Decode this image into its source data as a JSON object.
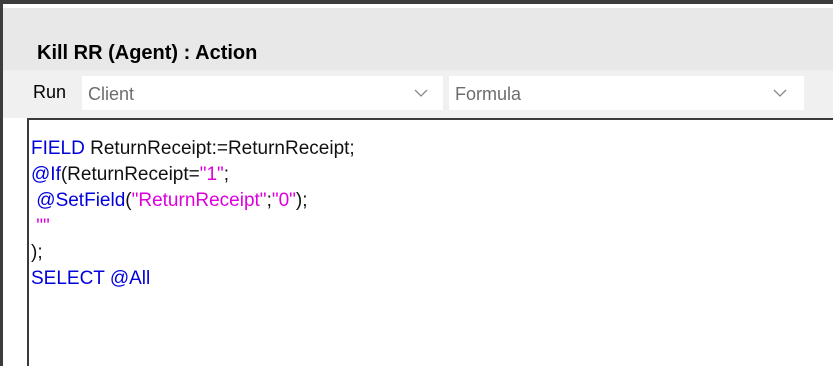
{
  "window": {
    "title": "Kill RR (Agent) : Action"
  },
  "run_row": {
    "label": "Run",
    "client_select": {
      "value": "Client",
      "icon": "chevron-down-icon"
    },
    "type_select": {
      "value": "Formula",
      "icon": "chevron-down-icon"
    }
  },
  "editor": {
    "line1": {
      "keyword": "FIELD",
      "text": " ReturnReceipt:=ReturnReceipt;"
    },
    "line2": {
      "keyword": "@If",
      "text_a": "(ReturnReceipt=",
      "string": "\"1\"",
      "text_b": ";"
    },
    "line3": {
      "indent": " ",
      "keyword": "@SetField",
      "text_a": "(",
      "string_a": "\"ReturnReceipt\"",
      "text_b": ";",
      "string_b": "\"0\"",
      "text_c": ");"
    },
    "line4": {
      "indent": " ",
      "string": "\"\""
    },
    "line5": {
      "text": ");"
    },
    "line6": {
      "keyword": "SELECT @All"
    }
  },
  "colors": {
    "keyword": "#0000dd",
    "string": "#dd00dd",
    "text": "#111111",
    "title_bar": "#e8e8e8",
    "run_row": "#f0f0f0"
  }
}
